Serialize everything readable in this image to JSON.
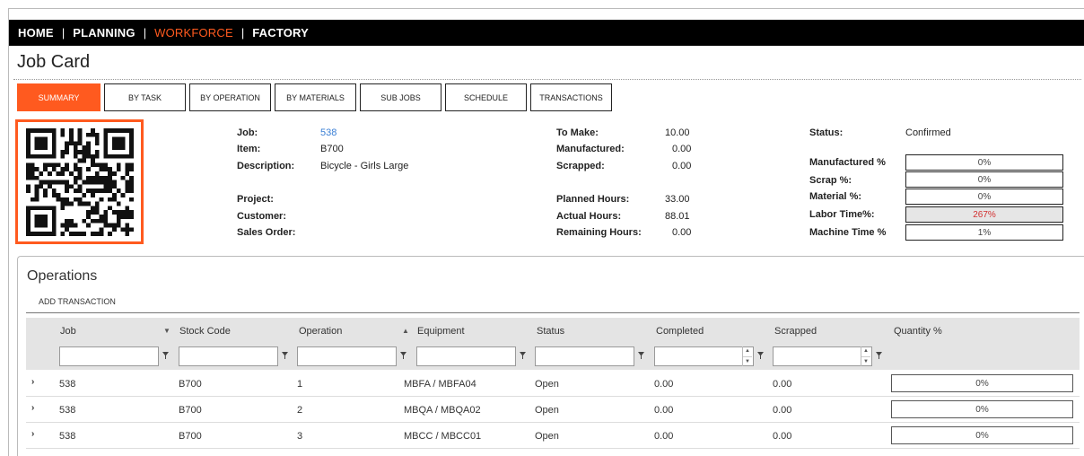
{
  "nav": {
    "items": [
      {
        "label": "HOME",
        "active": false
      },
      {
        "label": "PLANNING",
        "active": false
      },
      {
        "label": "WORKFORCE",
        "active": true
      },
      {
        "label": "FACTORY",
        "active": false
      }
    ],
    "separator": "|"
  },
  "page": {
    "title": "Job Card"
  },
  "tabs": [
    {
      "label": "SUMMARY",
      "active": true
    },
    {
      "label": "BY TASK",
      "active": false
    },
    {
      "label": "BY OPERATION",
      "active": false
    },
    {
      "label": "BY MATERIALS",
      "active": false
    },
    {
      "label": "SUB JOBS",
      "active": false
    },
    {
      "label": "SCHEDULE",
      "active": false
    },
    {
      "label": "TRANSACTIONS",
      "active": false
    }
  ],
  "job_info": {
    "job_label": "Job:",
    "job_value": "538",
    "item_label": "Item:",
    "item_value": "B700",
    "description_label": "Description:",
    "description_value": "Bicycle - Girls Large",
    "project_label": "Project:",
    "customer_label": "Customer:",
    "sales_order_label": "Sales Order:"
  },
  "quantities": {
    "to_make_label": "To Make:",
    "to_make_value": "10.00",
    "manufactured_label": "Manufactured:",
    "manufactured_value": "0.00",
    "scrapped_label": "Scrapped:",
    "scrapped_value": "0.00",
    "planned_hours_label": "Planned Hours:",
    "planned_hours_value": "33.00",
    "actual_hours_label": "Actual Hours:",
    "actual_hours_value": "88.01",
    "remaining_hours_label": "Remaining Hours:",
    "remaining_hours_value": "0.00"
  },
  "status_panel": {
    "status_label": "Status:",
    "status_value": "Confirmed",
    "metrics": [
      {
        "label": "Manufactured %",
        "value": "0%",
        "alert": false
      },
      {
        "label": "Scrap %:",
        "value": "0%",
        "alert": false
      },
      {
        "label": "Material %:",
        "value": "0%",
        "alert": false
      },
      {
        "label": "Labor Time%:",
        "value": "267%",
        "alert": true
      },
      {
        "label": "Machine Time %",
        "value": "1%",
        "alert": false
      }
    ]
  },
  "operations": {
    "title": "Operations",
    "add_transaction_label": "ADD TRANSACTION",
    "columns": [
      "Job",
      "Stock Code",
      "Operation",
      "Equipment",
      "Status",
      "Completed",
      "Scrapped",
      "Quantity %"
    ],
    "rows": [
      {
        "job": "538",
        "stock_code": "B700",
        "operation": "1",
        "equipment": "MBFA / MBFA04",
        "status": "Open",
        "completed": "0.00",
        "scrapped": "0.00",
        "quantity_pct": "0%"
      },
      {
        "job": "538",
        "stock_code": "B700",
        "operation": "2",
        "equipment": "MBQA / MBQA02",
        "status": "Open",
        "completed": "0.00",
        "scrapped": "0.00",
        "quantity_pct": "0%"
      },
      {
        "job": "538",
        "stock_code": "B700",
        "operation": "3",
        "equipment": "MBCC / MBCC01",
        "status": "Open",
        "completed": "0.00",
        "scrapped": "0.00",
        "quantity_pct": "0%"
      }
    ]
  },
  "colors": {
    "accent": "#ff5a1f",
    "nav_bg": "#000000",
    "link": "#3a7fd5",
    "alert": "#d32f2f",
    "grid_header": "#e4e4e4"
  },
  "icons": {
    "qr_code": "qr-code-icon",
    "filter": "filter-icon",
    "expand": "chevron-right-icon",
    "sort_desc": "sort-desc-icon",
    "sort_asc": "sort-asc-icon"
  }
}
